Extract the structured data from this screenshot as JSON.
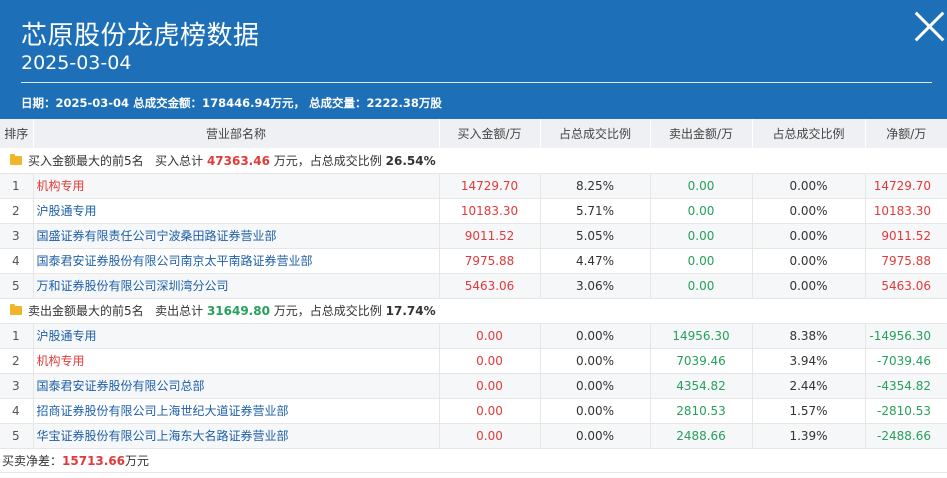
{
  "header": {
    "title": "芯原股份龙虎榜数据",
    "date": "2025-03-04",
    "summary": "日期：2025-03-04 总成交金额：178446.94万元， 总成交量：2222.38万股"
  },
  "columns": [
    "排序",
    "营业部名称",
    "买入金额/万",
    "占总成交比例",
    "卖出金额/万",
    "占总成交比例",
    "净额/万"
  ],
  "buy_section": {
    "label": "买入金额最大的前5名",
    "total_prefix": "买入总计",
    "total_value": "47363.46",
    "total_suffix": "万元，占总成交比例",
    "ratio": "26.54%"
  },
  "buy_rows": [
    {
      "idx": "1",
      "name": "机构专用",
      "buy": "14729.70",
      "buy_ratio": "8.25%",
      "sell": "0.00",
      "sell_ratio": "0.00%",
      "net": "14729.70"
    },
    {
      "idx": "2",
      "name": "沪股通专用",
      "buy": "10183.30",
      "buy_ratio": "5.71%",
      "sell": "0.00",
      "sell_ratio": "0.00%",
      "net": "10183.30"
    },
    {
      "idx": "3",
      "name": "国盛证券有限责任公司宁波桑田路证券营业部",
      "buy": "9011.52",
      "buy_ratio": "5.05%",
      "sell": "0.00",
      "sell_ratio": "0.00%",
      "net": "9011.52"
    },
    {
      "idx": "4",
      "name": "国泰君安证券股份有限公司南京太平南路证券营业部",
      "buy": "7975.88",
      "buy_ratio": "4.47%",
      "sell": "0.00",
      "sell_ratio": "0.00%",
      "net": "7975.88"
    },
    {
      "idx": "5",
      "name": "万和证券股份有限公司深圳湾分公司",
      "buy": "5463.06",
      "buy_ratio": "3.06%",
      "sell": "0.00",
      "sell_ratio": "0.00%",
      "net": "5463.06"
    }
  ],
  "sell_section": {
    "label": "卖出金额最大的前5名",
    "total_prefix": "卖出总计",
    "total_value": "31649.80",
    "total_suffix": "万元，占总成交比例",
    "ratio": "17.74%"
  },
  "sell_rows": [
    {
      "idx": "1",
      "name": "沪股通专用",
      "buy": "0.00",
      "buy_ratio": "0.00%",
      "sell": "14956.30",
      "sell_ratio": "8.38%",
      "net": "-14956.30"
    },
    {
      "idx": "2",
      "name": "机构专用",
      "buy": "0.00",
      "buy_ratio": "0.00%",
      "sell": "7039.46",
      "sell_ratio": "3.94%",
      "net": "-7039.46"
    },
    {
      "idx": "3",
      "name": "国泰君安证券股份有限公司总部",
      "buy": "0.00",
      "buy_ratio": "0.00%",
      "sell": "4354.82",
      "sell_ratio": "2.44%",
      "net": "-4354.82"
    },
    {
      "idx": "4",
      "name": "招商证券股份有限公司上海世纪大道证券营业部",
      "buy": "0.00",
      "buy_ratio": "0.00%",
      "sell": "2810.53",
      "sell_ratio": "1.57%",
      "net": "-2810.53"
    },
    {
      "idx": "5",
      "name": "华宝证券股份有限公司上海东大名路证券营业部",
      "buy": "0.00",
      "buy_ratio": "0.00%",
      "sell": "2488.66",
      "sell_ratio": "1.39%",
      "net": "-2488.66"
    }
  ],
  "footer": {
    "label": "买卖净差：",
    "value": "15713.66",
    "unit": "万元"
  },
  "colors": {
    "header_bg": "#1d6fb7",
    "positive": "#e03a3a",
    "negative": "#26a05a",
    "link": "#1d5fa8"
  },
  "icons": {
    "close": "close-icon",
    "section": "folder-icon"
  }
}
